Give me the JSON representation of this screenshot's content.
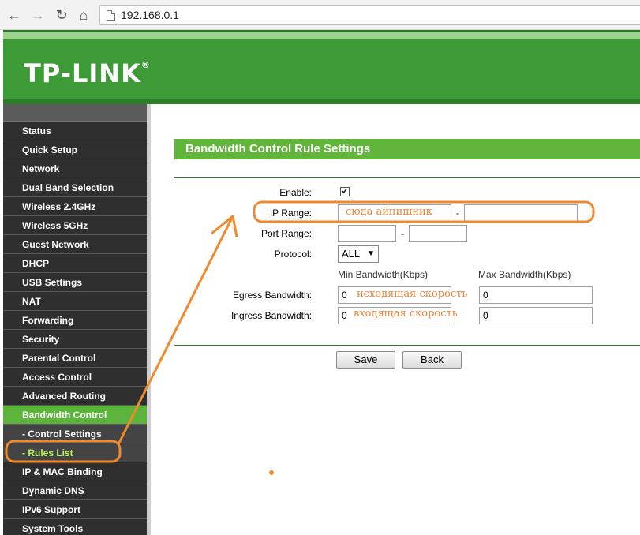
{
  "browser": {
    "url": "192.168.0.1",
    "back_icon": "arrow-left-icon",
    "forward_icon": "arrow-right-icon",
    "reload_icon": "reload-icon",
    "home_icon": "home-icon"
  },
  "header": {
    "logo": "TP-LINK",
    "logo_mark": "®",
    "color": "#3d9b37"
  },
  "nav": {
    "items": [
      {
        "label": "Status"
      },
      {
        "label": "Quick Setup"
      },
      {
        "label": "Network"
      },
      {
        "label": "Dual Band Selection"
      },
      {
        "label": "Wireless 2.4GHz"
      },
      {
        "label": "Wireless 5GHz"
      },
      {
        "label": "Guest Network"
      },
      {
        "label": "DHCP"
      },
      {
        "label": "USB Settings"
      },
      {
        "label": "NAT"
      },
      {
        "label": "Forwarding"
      },
      {
        "label": "Security"
      },
      {
        "label": "Parental Control"
      },
      {
        "label": "Access Control"
      },
      {
        "label": "Advanced Routing"
      },
      {
        "label": "Bandwidth Control"
      },
      {
        "label": "- Control Settings"
      },
      {
        "label": "- Rules List"
      },
      {
        "label": "IP & MAC Binding"
      },
      {
        "label": "Dynamic DNS"
      },
      {
        "label": "IPv6 Support"
      },
      {
        "label": "System Tools"
      }
    ],
    "active_color": "#5cb43c"
  },
  "form": {
    "title": "Bandwidth Control Rule Settings",
    "enable_label": "Enable:",
    "enable_checked": true,
    "ip_range_label": "IP Range:",
    "ip_range_start": "",
    "ip_range_end": "",
    "port_range_label": "Port Range:",
    "port_range_start": "",
    "port_range_end": "",
    "dash": "-",
    "protocol_label": "Protocol:",
    "protocol_value": "ALL",
    "min_bw_header": "Min Bandwidth(Kbps)",
    "max_bw_header": "Max Bandwidth(Kbps)",
    "egress_label": "Egress Bandwidth:",
    "egress_min": "0",
    "egress_max": "0",
    "ingress_label": "Ingress Bandwidth:",
    "ingress_min": "0",
    "ingress_max": "0",
    "save_label": "Save",
    "back_label": "Back"
  },
  "annotations": {
    "ip_note": "сюда айпишник",
    "egress_note": "исходящая скорость",
    "ingress_note": "входящая скорость",
    "color": "#f08a2c"
  }
}
